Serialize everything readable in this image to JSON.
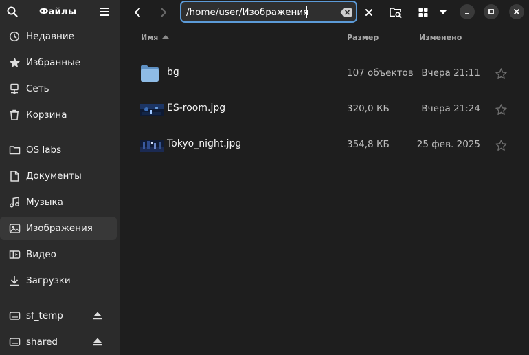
{
  "sidebar": {
    "title": "Файлы",
    "places": [
      {
        "label": "Недавние",
        "icon": "clock-icon"
      },
      {
        "label": "Избранные",
        "icon": "star-icon"
      },
      {
        "label": "Сеть",
        "icon": "network-icon"
      },
      {
        "label": "Корзина",
        "icon": "trash-icon"
      }
    ],
    "bookmarks": [
      {
        "label": "OS labs",
        "icon": "folder-icon"
      },
      {
        "label": "Документы",
        "icon": "document-icon"
      },
      {
        "label": "Музыка",
        "icon": "music-icon"
      },
      {
        "label": "Изображения",
        "icon": "image-icon",
        "active": true
      },
      {
        "label": "Видео",
        "icon": "video-icon"
      },
      {
        "label": "Загрузки",
        "icon": "download-icon"
      }
    ],
    "devices": [
      {
        "label": "sf_temp",
        "icon": "drive-icon"
      },
      {
        "label": "shared",
        "icon": "drive-icon"
      }
    ]
  },
  "header": {
    "path": "/home/user/Изображения"
  },
  "columns": {
    "name": "Имя",
    "size": "Размер",
    "modified": "Изменено"
  },
  "files": [
    {
      "name": "bg",
      "size": "107 объектов",
      "modified": "Вчера 21:11",
      "type": "folder"
    },
    {
      "name": "ES-room.jpg",
      "size": "320,0 КБ",
      "modified": "Вчера 21:24",
      "type": "image"
    },
    {
      "name": "Tokyo_night.jpg",
      "size": "354,8 КБ",
      "modified": "25 фев. 2025",
      "type": "image"
    }
  ],
  "colors": {
    "sidebar_bg": "#2b2b2b",
    "content_bg": "#1e1e1e",
    "accent": "#5c9bd8",
    "folder": "#8fbce6"
  }
}
